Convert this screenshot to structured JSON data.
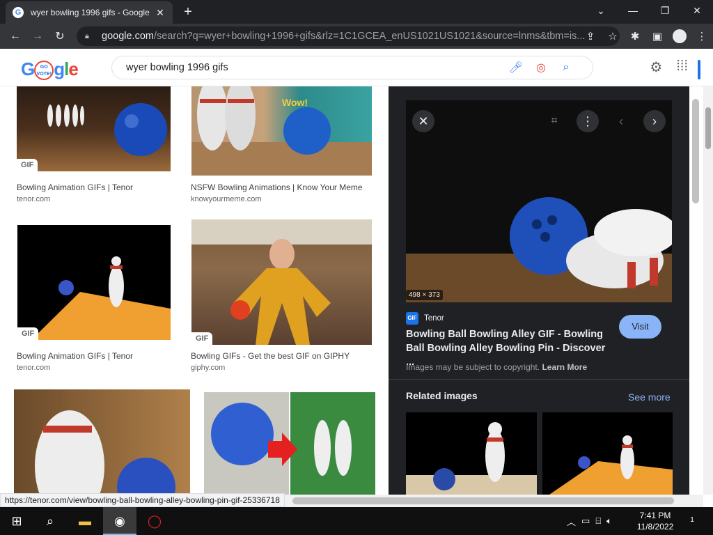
{
  "browser": {
    "tab_title": "wyer bowling 1996 gifs - Google",
    "tab_close": "✕",
    "new_tab": "+",
    "url_host": "google.com",
    "url_path": "/search?q=wyer+bowling+1996+gifs&rlz=1C1GCEA_enUS1021US1021&source=lnms&tbm=is...",
    "status_url": "https://tenor.com/view/bowling-ball-bowling-alley-bowling-pin-gif-25336718"
  },
  "google": {
    "logo_letters": [
      "G",
      "o",
      "g",
      "l",
      "e"
    ],
    "doodle_text_1": "GO",
    "doodle_text_2": "VOTE!",
    "search_query": "wyer bowling 1996 gifs"
  },
  "results": [
    {
      "title": "Bowling Animation GIFs | Tenor",
      "source": "tenor.com",
      "badge": "GIF"
    },
    {
      "title": "NSFW Bowling Animations | Know Your Meme",
      "source": "knowyourmeme.com",
      "badge": ""
    },
    {
      "title": "Bowling Animation GIFs | Tenor",
      "source": "tenor.com",
      "badge": "GIF"
    },
    {
      "title": "Bowling GIFs - Get the best GIF on GIPHY",
      "source": "giphy.com",
      "badge": "GIF"
    }
  ],
  "result_art": {
    "wow_text": "Wow!"
  },
  "panel": {
    "dimensions": "498 × 373",
    "source_badge": "GIF",
    "source_name": "Tenor",
    "title": "Bowling Ball Bowling Alley GIF - Bowling Ball Bowling Alley Bowling Pin - Discover ...",
    "visit_label": "Visit",
    "copyright_text": "Images may be subject to copyright.",
    "learn_more": "Learn More",
    "related_label": "Related images",
    "see_more": "See more"
  },
  "taskbar": {
    "time": "7:41 PM",
    "date": "11/8/2022",
    "notifications": "1"
  },
  "colors": {
    "accent": "#1a73e8",
    "visit_button": "#8ab4f8",
    "panel_bg": "#202124"
  },
  "icons": [
    "google-favicon",
    "back-arrow-icon",
    "forward-arrow-icon",
    "reload-icon",
    "lock-icon",
    "share-icon",
    "star-icon",
    "extensions-icon",
    "sidebar-icon",
    "profile-icon",
    "menu-icon",
    "mic-icon",
    "lens-icon",
    "search-icon",
    "gear-icon",
    "apps-icon",
    "close-icon",
    "more-icon",
    "chevron-left-icon",
    "chevron-right-icon",
    "windows-icon",
    "taskbar-search-icon",
    "file-explorer-icon",
    "chrome-icon",
    "opera-icon"
  ]
}
